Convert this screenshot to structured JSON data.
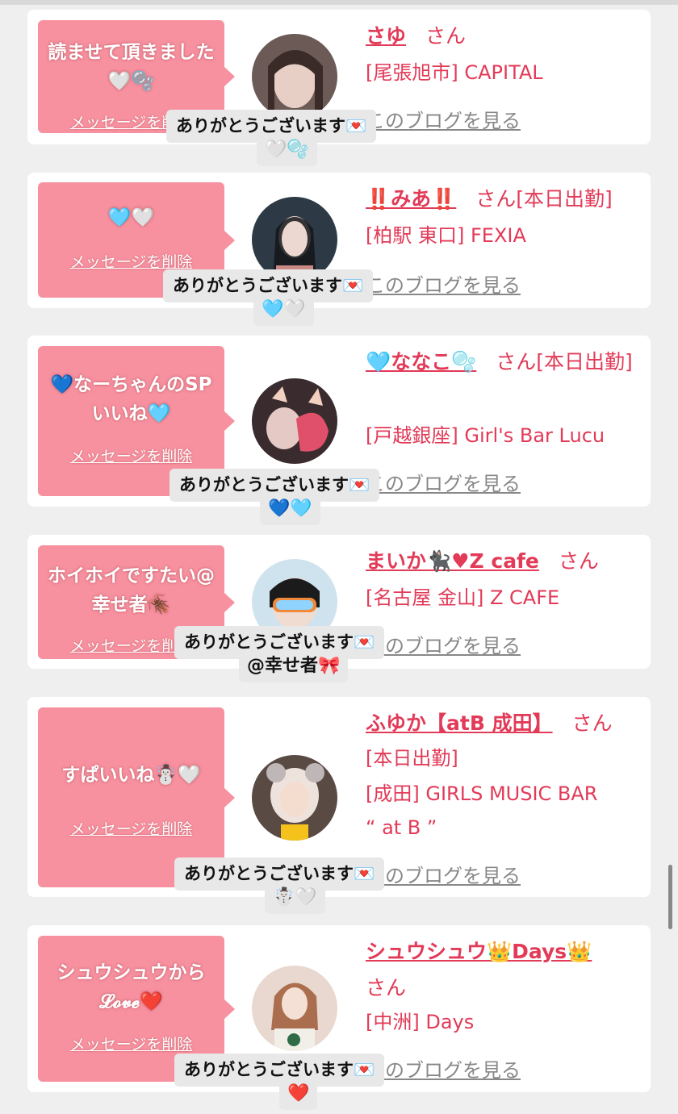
{
  "colors": {
    "accent": "#e23a57",
    "bubble": "#f7919f",
    "background": "#efefef"
  },
  "cards": [
    {
      "message": "読ませて頂きました🤍🫧",
      "delete_label": "メッセージを削除",
      "name": "さゆ",
      "san": "さん",
      "info": [
        "[尾張旭市] CAPITAL"
      ],
      "blog": "このブログを見る",
      "thanks": "ありがとうございます💌",
      "thanks_suffix": "🤍🫧"
    },
    {
      "message": "🩵🤍",
      "delete_label": "メッセージを削除",
      "name": "‼️みあ‼️",
      "san": "さん[本日出勤]",
      "info": [
        "[柏駅 東口] FEXIA"
      ],
      "blog": "このブログを見る",
      "thanks": "ありがとうございます💌",
      "thanks_suffix": "🩵🤍"
    },
    {
      "message": "💙なーちゃんのSPいいね🩵",
      "delete_label": "メッセージを削除",
      "name": "🩵ななこ🫧",
      "san": "さん[本日出勤]",
      "info": [
        "[戸越銀座] Girl's Bar Lucu"
      ],
      "blog": "このブログを見る",
      "thanks": "ありがとうございます💌",
      "thanks_suffix": "💙🩵"
    },
    {
      "message": "ホイホイですたい@幸せ者🪳",
      "delete_label": "メッセージを削除",
      "name": "まいか🐈‍⬛♥Z cafe",
      "san": "さん",
      "info": [
        "[名古屋 金山] Z CAFE"
      ],
      "blog": "このブログを見る",
      "thanks": "ありがとうございます💌",
      "thanks_suffix": "@幸せ者🎀"
    },
    {
      "message": "すぱいいね☃️🤍",
      "delete_label": "メッセージを削除",
      "name": "ふゆか【atB 成田】",
      "san": "さん",
      "info": [
        "[本日出勤]",
        "[成田] GIRLS MUSIC BAR",
        "“ at B ”"
      ],
      "blog": "このブログを見る",
      "thanks": "ありがとうございます💌",
      "thanks_suffix": "☃️🤍"
    },
    {
      "message": "シュウシュウから𝓛𝓸𝓿𝓮❤️",
      "delete_label": "メッセージを削除",
      "name": "シュウシュウ👑Days👑",
      "san": "さん",
      "info": [
        "[中洲] Days"
      ],
      "blog": "このブログを見る",
      "thanks": "ありがとうございます💌",
      "thanks_suffix": "❤️"
    }
  ]
}
